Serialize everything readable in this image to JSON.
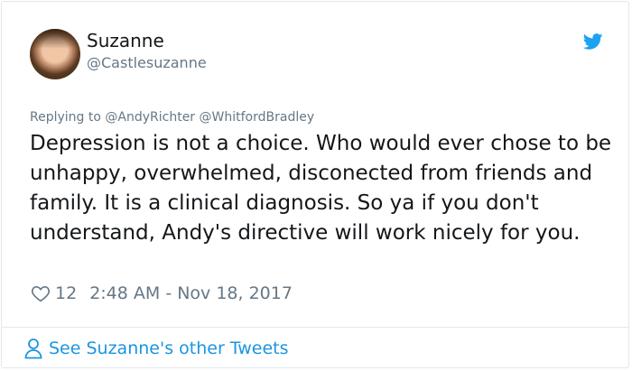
{
  "author": {
    "name": "Suzanne",
    "handle": "@Castlesuzanne",
    "avatar_icon": "profile-photo"
  },
  "reply_line": {
    "prefix": "Replying to",
    "mentions": [
      "@AndyRichter",
      "@WhitfordBradley"
    ]
  },
  "tweet": {
    "text": "Depression is not a choice. Who would ever chose to be unhappy, overwhelmed,  disconected from friends and family. It is a clinical diagnosis. So ya if you don't understand, Andy's directive will work nicely for you.",
    "likes": "12",
    "timestamp": "2:48 AM - Nov 18, 2017"
  },
  "footer": {
    "link_text": "See Suzanne's other Tweets"
  },
  "colors": {
    "twitter_blue": "#1da1f2",
    "link_blue": "#1b95e0",
    "muted_gray": "#657786",
    "border": "#e1e8ed"
  },
  "icons": [
    "twitter-bird-icon",
    "heart-icon",
    "person-icon"
  ]
}
